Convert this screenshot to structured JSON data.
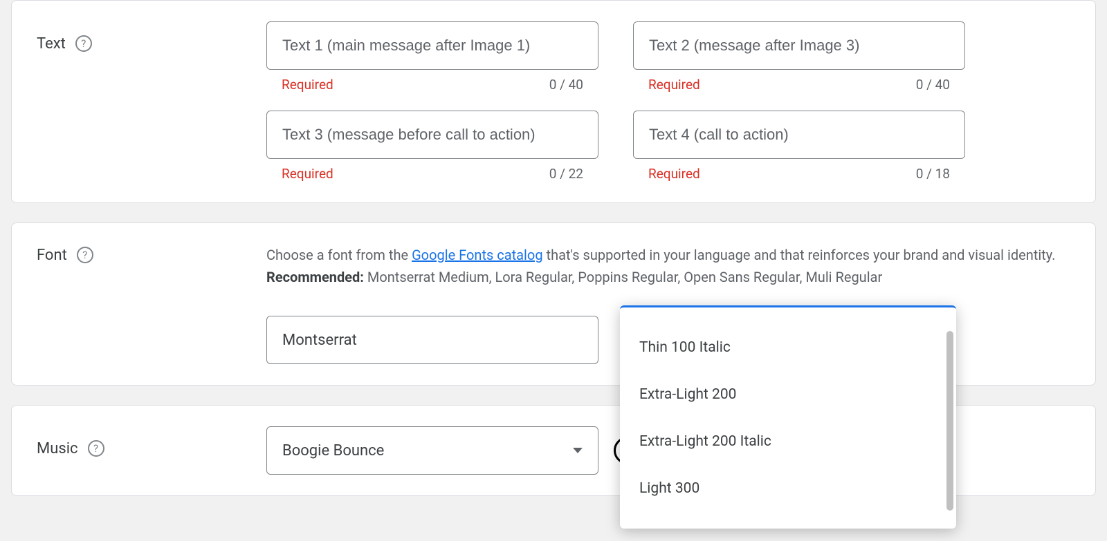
{
  "text": {
    "label": "Text",
    "fields": [
      {
        "placeholder": "Text 1 (main message after Image 1)",
        "required": "Required",
        "count": "0 / 40"
      },
      {
        "placeholder": "Text 2 (message after Image 3)",
        "required": "Required",
        "count": "0 / 40"
      },
      {
        "placeholder": "Text 3 (message before call to action)",
        "required": "Required",
        "count": "0 / 22"
      },
      {
        "placeholder": "Text 4 (call to action)",
        "required": "Required",
        "count": "0 / 18"
      }
    ]
  },
  "font": {
    "label": "Font",
    "desc_pre": "Choose a font from the ",
    "desc_link": "Google Fonts catalog",
    "desc_post": " that's supported in your language and that reinforces your brand and visual identity.",
    "recommended_label": "Recommended:",
    "recommended_list": " Montserrat Medium, Lora Regular, Poppins Regular, Open Sans Regular, Muli Regular",
    "value": "Montserrat",
    "weight_options": [
      "Thin 100 Italic",
      "Extra-Light 200",
      "Extra-Light 200 Italic",
      "Light 300"
    ]
  },
  "music": {
    "label": "Music",
    "value": "Boogie Bounce"
  }
}
